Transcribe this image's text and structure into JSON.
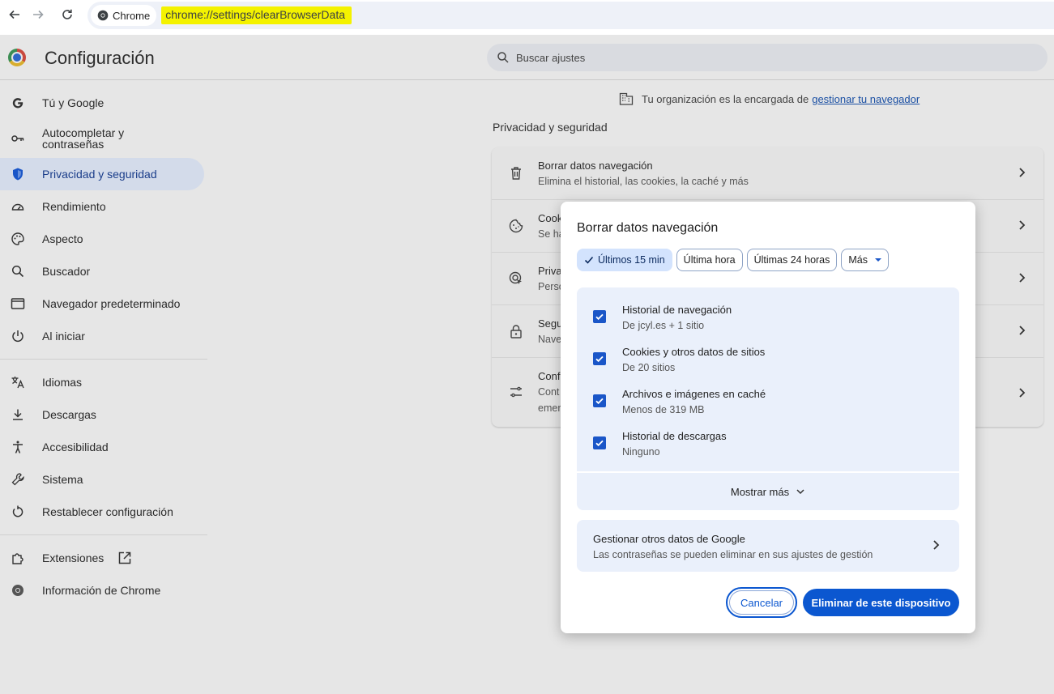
{
  "browser": {
    "chip_label": "Chrome",
    "url": "chrome://settings/clearBrowserData"
  },
  "header": {
    "title": "Configuración",
    "search_placeholder": "Buscar ajustes"
  },
  "sidebar": {
    "group1": [
      {
        "label": "Tú y Google",
        "icon": "google-g-icon"
      },
      {
        "label": "Autocompletar y contraseñas",
        "icon": "key-icon"
      },
      {
        "label": "Privacidad y seguridad",
        "icon": "shield-icon",
        "active": true
      },
      {
        "label": "Rendimiento",
        "icon": "speedometer-icon"
      },
      {
        "label": "Aspecto",
        "icon": "palette-icon"
      },
      {
        "label": "Buscador",
        "icon": "search-icon"
      },
      {
        "label": "Navegador predeterminado",
        "icon": "browser-icon"
      },
      {
        "label": "Al iniciar",
        "icon": "power-icon"
      }
    ],
    "group2": [
      {
        "label": "Idiomas",
        "icon": "translate-icon"
      },
      {
        "label": "Descargas",
        "icon": "download-icon"
      },
      {
        "label": "Accesibilidad",
        "icon": "accessibility-icon"
      },
      {
        "label": "Sistema",
        "icon": "wrench-icon"
      },
      {
        "label": "Restablecer configuración",
        "icon": "reset-icon"
      }
    ],
    "group3": [
      {
        "label": "Extensiones",
        "icon": "extension-icon"
      },
      {
        "label": "Información de Chrome",
        "icon": "chrome-icon"
      }
    ]
  },
  "main": {
    "org_note": "Tu organización es la encargada de",
    "org_link": "gestionar tu navegador",
    "section_title": "Privacidad y seguridad",
    "rows": [
      {
        "title": "Borrar datos navegación",
        "subtitle": "Elimina el historial, las cookies, la caché y más",
        "icon": "trash-icon"
      },
      {
        "title": "Cook",
        "subtitle": "Se ha",
        "icon": "cookie-icon"
      },
      {
        "title": "Priva",
        "subtitle": "Perso",
        "icon": "ads-privacy-icon"
      },
      {
        "title": "Segu",
        "subtitle": "Nave",
        "icon": "lock-icon"
      },
      {
        "title": "Conf",
        "subtitle": "Cont",
        "subtitle2": "emer",
        "icon": "tune-icon"
      }
    ]
  },
  "dialog": {
    "title": "Borrar datos navegación",
    "ranges": [
      "Últimos 15 min",
      "Última hora",
      "Últimas 24 horas",
      "Más"
    ],
    "selected_range": "Últimos 15 min",
    "items": [
      {
        "title": "Historial de navegación",
        "detail": "De jcyl.es + 1 sitio",
        "checked": true
      },
      {
        "title": "Cookies y otros datos de sitios",
        "detail": "De 20 sitios",
        "checked": true
      },
      {
        "title": "Archivos e imágenes en caché",
        "detail": "Menos de 319 MB",
        "checked": true
      },
      {
        "title": "Historial de descargas",
        "detail": "Ninguno",
        "checked": true
      }
    ],
    "show_more": "Mostrar más",
    "google_title": "Gestionar otros datos de Google",
    "google_subtitle": "Las contraseñas se pueden eliminar en sus ajustes de gestión",
    "cancel_label": "Cancelar",
    "delete_label": "Eliminar de este dispositivo"
  },
  "colors": {
    "accent": "#0b57d0",
    "url_highlight": "#f4f200",
    "active_nav": "#d3dbea"
  }
}
